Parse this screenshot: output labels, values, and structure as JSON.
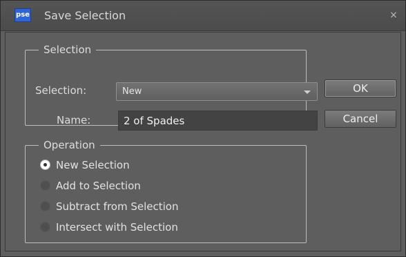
{
  "window": {
    "app_icon_text": "pse",
    "title": "Save Selection",
    "close_glyph": "×"
  },
  "selection_group": {
    "legend": "Selection",
    "selection_label": "Selection:",
    "selection_value": "New",
    "name_label": "Name:",
    "name_value": "2 of Spades"
  },
  "operation_group": {
    "legend": "Operation",
    "options": [
      {
        "label": "New Selection",
        "selected": true
      },
      {
        "label": "Add to Selection",
        "selected": false
      },
      {
        "label": "Subtract from Selection",
        "selected": false
      },
      {
        "label": "Intersect with Selection",
        "selected": false
      }
    ]
  },
  "buttons": {
    "ok": "OK",
    "cancel": "Cancel"
  }
}
